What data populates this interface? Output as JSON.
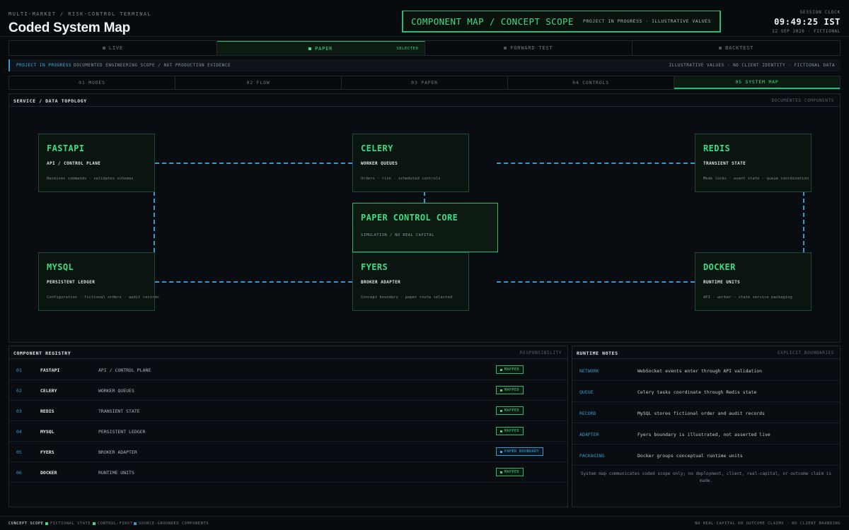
{
  "header": {
    "eyebrow": "MULTI-MARKET / RISK-CONTROL TERMINAL",
    "title": "Coded System Map",
    "banner_title": "COMPONENT MAP / CONCEPT SCOPE",
    "banner_sub": "PROJECT IN PROGRESS · ILLUSTRATIVE VALUES",
    "clock_label": "SESSION CLOCK",
    "clock_time": "09:49:25 IST",
    "clock_date": "12 SEP 2026 · FICTIONAL"
  },
  "modes": {
    "live": "LIVE",
    "paper": "PAPER",
    "selected": "SELECTED",
    "forward": "FORWARD TEST",
    "backtest": "BACKTEST"
  },
  "project_bar": {
    "label": "PROJECT IN PROGRESS",
    "message": "DOCUMENTED ENGINEERING SCOPE / NOT PRODUCTION EVIDENCE",
    "right": "ILLUSTRATIVE VALUES · NO CLIENT IDENTITY · FICTIONAL DATA"
  },
  "section_tabs": [
    "01 MODES",
    "02 FLOW",
    "03 PAPER",
    "04 CONTROLS",
    "05 SYSTEM MAP"
  ],
  "topology": {
    "heading": "SERVICE / DATA TOPOLOGY",
    "right": "DOCUMENTED COMPONENTS",
    "nodes": {
      "fastapi": {
        "name": "FASTAPI",
        "role": "API / CONTROL PLANE",
        "desc": "Receives commands · validates schemas"
      },
      "celery": {
        "name": "CELERY",
        "role": "WORKER QUEUES",
        "desc": "Orders · risk · scheduled controls"
      },
      "redis": {
        "name": "REDIS",
        "role": "TRANSIENT STATE",
        "desc": "Mode locks · event state · queue coordination"
      },
      "core": {
        "name": "PAPER CONTROL CORE",
        "role": "SIMULATION / NO REAL CAPITAL"
      },
      "mysql": {
        "name": "MYSQL",
        "role": "PERSISTENT LEDGER",
        "desc": "Configuration · fictional orders · audit records"
      },
      "fyers": {
        "name": "FYERS",
        "role": "BROKER ADAPTER",
        "desc": "Concept boundary · paper route selected"
      },
      "docker": {
        "name": "DOCKER",
        "role": "RUNTIME UNITS",
        "desc": "API · worker · state service packaging"
      }
    }
  },
  "registry": {
    "heading": "COMPONENT REGISTRY",
    "right": "RESPONSIBILITY",
    "rows": [
      {
        "id": "01",
        "name": "FASTAPI",
        "role": "API / CONTROL PLANE",
        "status": "MAPPED"
      },
      {
        "id": "02",
        "name": "CELERY",
        "role": "WORKER QUEUES",
        "status": "MAPPED"
      },
      {
        "id": "03",
        "name": "REDIS",
        "role": "TRANSIENT STATE",
        "status": "MAPPED"
      },
      {
        "id": "04",
        "name": "MYSQL",
        "role": "PERSISTENT LEDGER",
        "status": "MAPPED"
      },
      {
        "id": "05",
        "name": "FYERS",
        "role": "BROKER ADAPTER",
        "status": "PAPER BOUNDARY"
      },
      {
        "id": "06",
        "name": "DOCKER",
        "role": "RUNTIME UNITS",
        "status": "MAPPED"
      }
    ]
  },
  "notes": {
    "heading": "RUNTIME NOTES",
    "right": "EXPLICIT BOUNDARIES",
    "rows": [
      {
        "key": "NETWORK",
        "text": "WebSocket events enter through API validation"
      },
      {
        "key": "QUEUE",
        "text": "Celery tasks coordinate through Redis state"
      },
      {
        "key": "RECORD",
        "text": "MySQL stores fictional order and audit records"
      },
      {
        "key": "ADAPTER",
        "text": "Fyers boundary is illustrated, not asserted live"
      },
      {
        "key": "PACKAGING",
        "text": "Docker groups conceptual runtime units"
      }
    ],
    "footnote": "System map communicates coded scope only; no deployment, client, real-capital, or outcome claim is made."
  },
  "footer": {
    "label": "CONCEPT SCOPE",
    "item1": "FICTIONAL STATE",
    "item2": "CONTROL-FIRST",
    "item3": "SOURCE-GROUNDED COMPONENTS",
    "right": "NO REAL-CAPITAL OR OUTCOME CLAIMS · NO CLIENT BRANDING"
  },
  "colors": {
    "accent_green": "#3ddc84",
    "accent_blue": "#2f9bd0",
    "background": "#080b0e"
  }
}
